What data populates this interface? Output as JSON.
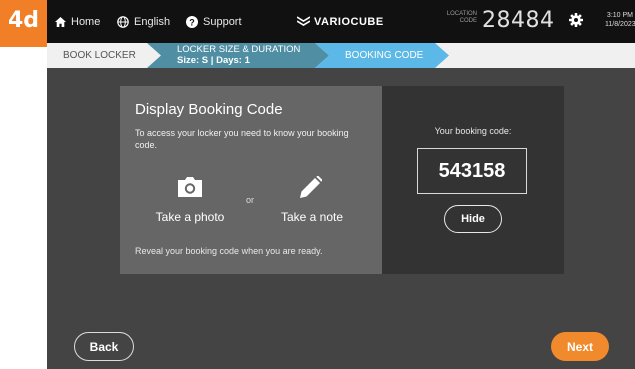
{
  "step_tag": "4d",
  "topbar": {
    "home_label": "Home",
    "language_label": "English",
    "support_label": "Support",
    "brand": "VARIOCUBE",
    "location_label_1": "LOCATION",
    "location_label_2": "CODE",
    "location_code": "28484",
    "time": "3:10 PM",
    "date": "11/8/2023"
  },
  "steps": {
    "step1": "BOOK LOCKER",
    "step2_title": "LOCKER SIZE & DURATION",
    "step2_sub": "Size: S | Days: 1",
    "step3": "BOOKING CODE",
    "colors": {
      "done": "#4f8ea3",
      "active": "#5cb8e6",
      "inactive": "#f0f0f0"
    }
  },
  "left_panel": {
    "title": "Display Booking Code",
    "description": "To access your locker you need to know your booking code.",
    "option_photo": "Take a photo",
    "or": "or",
    "option_note": "Take a note",
    "reveal_text": "Reveal your booking code when you are ready."
  },
  "right_panel": {
    "code_label": "Your booking code:",
    "code": "543158",
    "hide_label": "Hide"
  },
  "footer": {
    "back_label": "Back",
    "next_label": "Next",
    "next_color": "#f08a2c"
  }
}
